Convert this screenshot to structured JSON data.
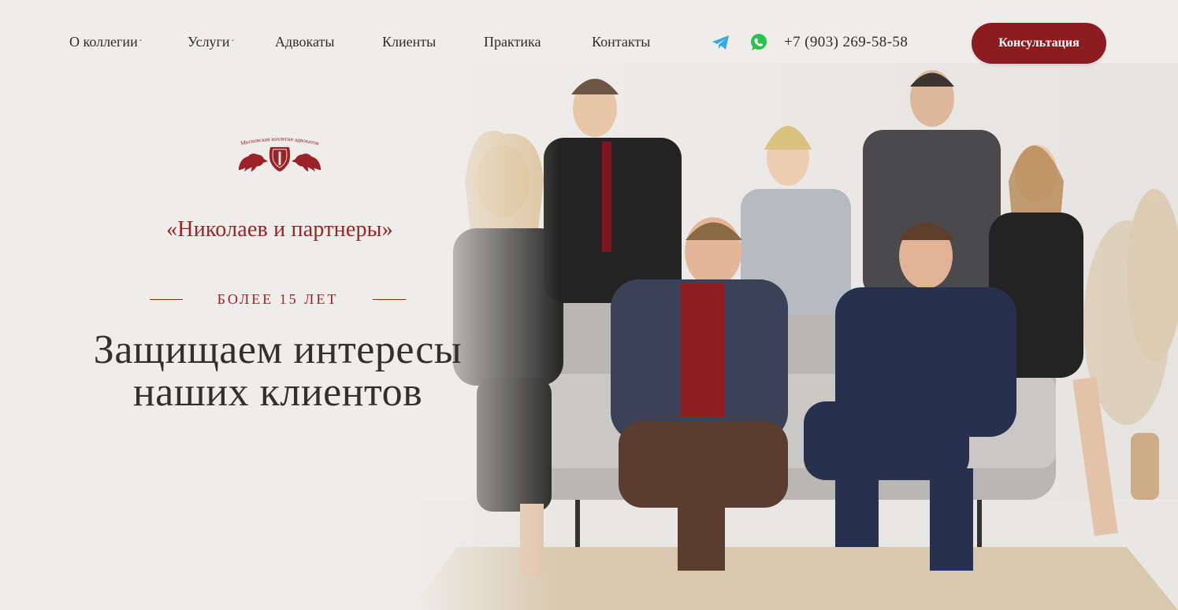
{
  "nav": {
    "items": [
      {
        "label": "О коллегии",
        "dropdown": true
      },
      {
        "label": "Услуги",
        "dropdown": true
      },
      {
        "label": "Адвокаты",
        "dropdown": false
      },
      {
        "label": "Клиенты",
        "dropdown": false
      },
      {
        "label": "Практика",
        "dropdown": false
      },
      {
        "label": "Контакты",
        "dropdown": false
      }
    ],
    "caret": "ˇ"
  },
  "contacts": {
    "phone": "+7 (903) 269-58-58",
    "icons": [
      "telegram-icon",
      "whatsapp-icon"
    ]
  },
  "cta": {
    "label": "Консультация"
  },
  "logo": {
    "top_text": "Московская коллегия адвокатов",
    "name": "«Николаев и партнеры»"
  },
  "hero": {
    "eyebrow": "БОЛЕЕ 15 ЛЕТ",
    "headline": "Защищаем интересы наших клиентов"
  },
  "colors": {
    "brand": "#8d1c20",
    "accent": "#9c1f25",
    "background": "#efedea",
    "text": "#2e2b2a",
    "telegram": "#35a9e0",
    "whatsapp": "#28c34c"
  }
}
